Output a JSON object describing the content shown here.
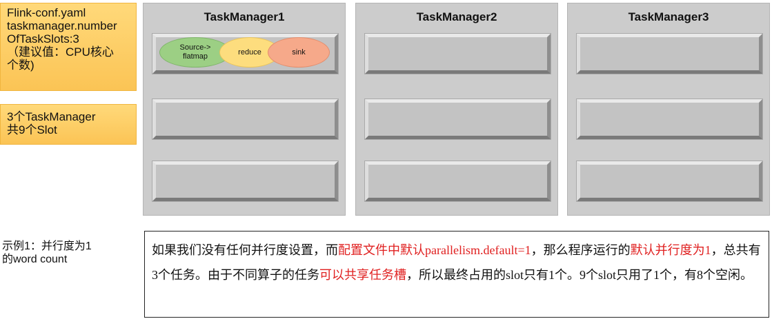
{
  "notes": {
    "config": "Flink-conf.yaml\ntaskmanager.number\nOfTaskSlots:3\n（建议值：CPU核心\n个数)",
    "summary": "3个TaskManager\n共9个Slot"
  },
  "task_managers": [
    {
      "title": "TaskManager1"
    },
    {
      "title": "TaskManager2"
    },
    {
      "title": "TaskManager3"
    }
  ],
  "operators": {
    "source": "Source->\nflatmap",
    "reduce": "reduce",
    "sink": "sink"
  },
  "example": {
    "label": "示例1：并行度为1\n的word count",
    "description": [
      {
        "text": "如果我们没有任何并行度设置，而",
        "color": "#111111"
      },
      {
        "text": "配置文件中默认parallelism.default=1",
        "color": "#e02020"
      },
      {
        "text": "，那么程序运行的",
        "color": "#111111"
      },
      {
        "text": "默认并行度为1",
        "color": "#e02020"
      },
      {
        "text": "，总共有3个任务。由于不同算子的任务",
        "color": "#111111"
      },
      {
        "text": "可以共享任务槽",
        "color": "#e02020"
      },
      {
        "text": "，所以最终占用的slot只有1个。9个slot只用了1个，有8个空闲。",
        "color": "#111111"
      }
    ]
  }
}
